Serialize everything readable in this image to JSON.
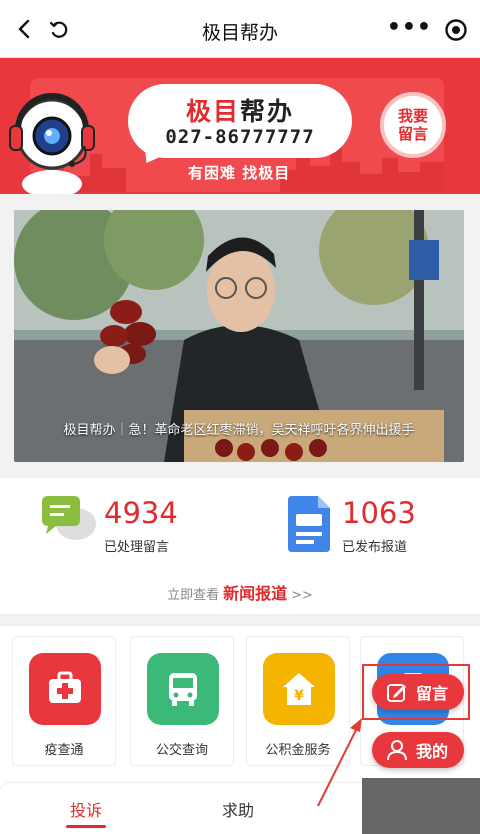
{
  "topbar": {
    "title": "极目帮办",
    "more_glyph": "•••"
  },
  "banner": {
    "brand_red": "极目",
    "brand_dark": "帮办",
    "phone": "027-86777777",
    "slogan": "有困难 找极目",
    "leave_msg_line1": "我要",
    "leave_msg_line2": "留言"
  },
  "feature": {
    "caption": "极目帮办｜急！革命老区红枣滞销，吴天祥呼吁各界伸出援手"
  },
  "stats": {
    "processed_count": "4934",
    "processed_label": "已处理留言",
    "published_count": "1063",
    "published_label": "已发布报道",
    "link_prefix": "立即查看",
    "link_main": "新闻报道",
    "link_suffix": ">>"
  },
  "services": [
    {
      "label": "疫查通",
      "icon": "medical-kit-icon",
      "color": "#e8383d"
    },
    {
      "label": "公交查询",
      "icon": "bus-icon",
      "color": "#3cb878"
    },
    {
      "label": "公积金服务",
      "icon": "housing-fund-icon",
      "color": "#f5b400"
    },
    {
      "label": "",
      "icon": "phone-icon",
      "color": "#2f86e6"
    }
  ],
  "tabs": [
    {
      "label": "投诉",
      "active": true
    },
    {
      "label": "求助",
      "active": false
    }
  ],
  "floating": {
    "message_label": "留言",
    "mine_label": "我的"
  },
  "colors": {
    "brand_red": "#e8383d",
    "accent_red": "#e32b2f"
  }
}
